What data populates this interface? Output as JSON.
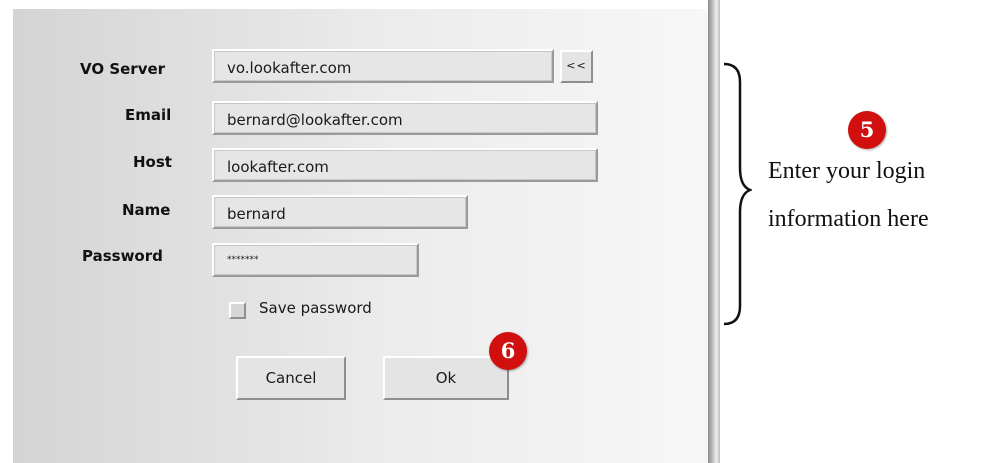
{
  "form": {
    "vo_server": {
      "label": "VO Server",
      "value": "vo.lookafter.com",
      "expand_label": "<<"
    },
    "email": {
      "label": "Email",
      "value": "bernard@lookafter.com"
    },
    "host": {
      "label": "Host",
      "value": "lookafter.com"
    },
    "name": {
      "label": "Name",
      "value": "bernard"
    },
    "password": {
      "label": "Password",
      "value": "*******"
    },
    "save_password": {
      "label": "Save password",
      "checked": false
    },
    "cancel_label": "Cancel",
    "ok_label": "Ok"
  },
  "annotations": {
    "step5": {
      "number": "5",
      "line1": "Enter your login",
      "line2": "information here"
    },
    "step6": {
      "number": "6"
    }
  },
  "colors": {
    "badge": "#d10f0f",
    "panel_bg": "#e6e6e6"
  }
}
